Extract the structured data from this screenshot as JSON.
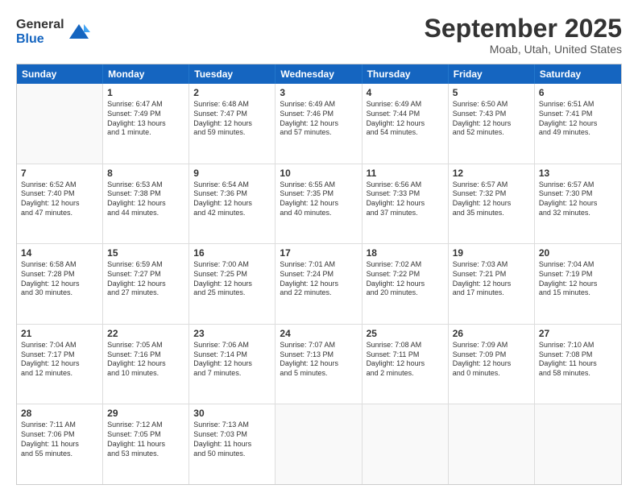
{
  "logo": {
    "general": "General",
    "blue": "Blue"
  },
  "title": "September 2025",
  "location": "Moab, Utah, United States",
  "weekdays": [
    "Sunday",
    "Monday",
    "Tuesday",
    "Wednesday",
    "Thursday",
    "Friday",
    "Saturday"
  ],
  "rows": [
    [
      {
        "day": "",
        "lines": []
      },
      {
        "day": "1",
        "lines": [
          "Sunrise: 6:47 AM",
          "Sunset: 7:49 PM",
          "Daylight: 13 hours",
          "and 1 minute."
        ]
      },
      {
        "day": "2",
        "lines": [
          "Sunrise: 6:48 AM",
          "Sunset: 7:47 PM",
          "Daylight: 12 hours",
          "and 59 minutes."
        ]
      },
      {
        "day": "3",
        "lines": [
          "Sunrise: 6:49 AM",
          "Sunset: 7:46 PM",
          "Daylight: 12 hours",
          "and 57 minutes."
        ]
      },
      {
        "day": "4",
        "lines": [
          "Sunrise: 6:49 AM",
          "Sunset: 7:44 PM",
          "Daylight: 12 hours",
          "and 54 minutes."
        ]
      },
      {
        "day": "5",
        "lines": [
          "Sunrise: 6:50 AM",
          "Sunset: 7:43 PM",
          "Daylight: 12 hours",
          "and 52 minutes."
        ]
      },
      {
        "day": "6",
        "lines": [
          "Sunrise: 6:51 AM",
          "Sunset: 7:41 PM",
          "Daylight: 12 hours",
          "and 49 minutes."
        ]
      }
    ],
    [
      {
        "day": "7",
        "lines": [
          "Sunrise: 6:52 AM",
          "Sunset: 7:40 PM",
          "Daylight: 12 hours",
          "and 47 minutes."
        ]
      },
      {
        "day": "8",
        "lines": [
          "Sunrise: 6:53 AM",
          "Sunset: 7:38 PM",
          "Daylight: 12 hours",
          "and 44 minutes."
        ]
      },
      {
        "day": "9",
        "lines": [
          "Sunrise: 6:54 AM",
          "Sunset: 7:36 PM",
          "Daylight: 12 hours",
          "and 42 minutes."
        ]
      },
      {
        "day": "10",
        "lines": [
          "Sunrise: 6:55 AM",
          "Sunset: 7:35 PM",
          "Daylight: 12 hours",
          "and 40 minutes."
        ]
      },
      {
        "day": "11",
        "lines": [
          "Sunrise: 6:56 AM",
          "Sunset: 7:33 PM",
          "Daylight: 12 hours",
          "and 37 minutes."
        ]
      },
      {
        "day": "12",
        "lines": [
          "Sunrise: 6:57 AM",
          "Sunset: 7:32 PM",
          "Daylight: 12 hours",
          "and 35 minutes."
        ]
      },
      {
        "day": "13",
        "lines": [
          "Sunrise: 6:57 AM",
          "Sunset: 7:30 PM",
          "Daylight: 12 hours",
          "and 32 minutes."
        ]
      }
    ],
    [
      {
        "day": "14",
        "lines": [
          "Sunrise: 6:58 AM",
          "Sunset: 7:28 PM",
          "Daylight: 12 hours",
          "and 30 minutes."
        ]
      },
      {
        "day": "15",
        "lines": [
          "Sunrise: 6:59 AM",
          "Sunset: 7:27 PM",
          "Daylight: 12 hours",
          "and 27 minutes."
        ]
      },
      {
        "day": "16",
        "lines": [
          "Sunrise: 7:00 AM",
          "Sunset: 7:25 PM",
          "Daylight: 12 hours",
          "and 25 minutes."
        ]
      },
      {
        "day": "17",
        "lines": [
          "Sunrise: 7:01 AM",
          "Sunset: 7:24 PM",
          "Daylight: 12 hours",
          "and 22 minutes."
        ]
      },
      {
        "day": "18",
        "lines": [
          "Sunrise: 7:02 AM",
          "Sunset: 7:22 PM",
          "Daylight: 12 hours",
          "and 20 minutes."
        ]
      },
      {
        "day": "19",
        "lines": [
          "Sunrise: 7:03 AM",
          "Sunset: 7:21 PM",
          "Daylight: 12 hours",
          "and 17 minutes."
        ]
      },
      {
        "day": "20",
        "lines": [
          "Sunrise: 7:04 AM",
          "Sunset: 7:19 PM",
          "Daylight: 12 hours",
          "and 15 minutes."
        ]
      }
    ],
    [
      {
        "day": "21",
        "lines": [
          "Sunrise: 7:04 AM",
          "Sunset: 7:17 PM",
          "Daylight: 12 hours",
          "and 12 minutes."
        ]
      },
      {
        "day": "22",
        "lines": [
          "Sunrise: 7:05 AM",
          "Sunset: 7:16 PM",
          "Daylight: 12 hours",
          "and 10 minutes."
        ]
      },
      {
        "day": "23",
        "lines": [
          "Sunrise: 7:06 AM",
          "Sunset: 7:14 PM",
          "Daylight: 12 hours",
          "and 7 minutes."
        ]
      },
      {
        "day": "24",
        "lines": [
          "Sunrise: 7:07 AM",
          "Sunset: 7:13 PM",
          "Daylight: 12 hours",
          "and 5 minutes."
        ]
      },
      {
        "day": "25",
        "lines": [
          "Sunrise: 7:08 AM",
          "Sunset: 7:11 PM",
          "Daylight: 12 hours",
          "and 2 minutes."
        ]
      },
      {
        "day": "26",
        "lines": [
          "Sunrise: 7:09 AM",
          "Sunset: 7:09 PM",
          "Daylight: 12 hours",
          "and 0 minutes."
        ]
      },
      {
        "day": "27",
        "lines": [
          "Sunrise: 7:10 AM",
          "Sunset: 7:08 PM",
          "Daylight: 11 hours",
          "and 58 minutes."
        ]
      }
    ],
    [
      {
        "day": "28",
        "lines": [
          "Sunrise: 7:11 AM",
          "Sunset: 7:06 PM",
          "Daylight: 11 hours",
          "and 55 minutes."
        ]
      },
      {
        "day": "29",
        "lines": [
          "Sunrise: 7:12 AM",
          "Sunset: 7:05 PM",
          "Daylight: 11 hours",
          "and 53 minutes."
        ]
      },
      {
        "day": "30",
        "lines": [
          "Sunrise: 7:13 AM",
          "Sunset: 7:03 PM",
          "Daylight: 11 hours",
          "and 50 minutes."
        ]
      },
      {
        "day": "",
        "lines": []
      },
      {
        "day": "",
        "lines": []
      },
      {
        "day": "",
        "lines": []
      },
      {
        "day": "",
        "lines": []
      }
    ]
  ]
}
